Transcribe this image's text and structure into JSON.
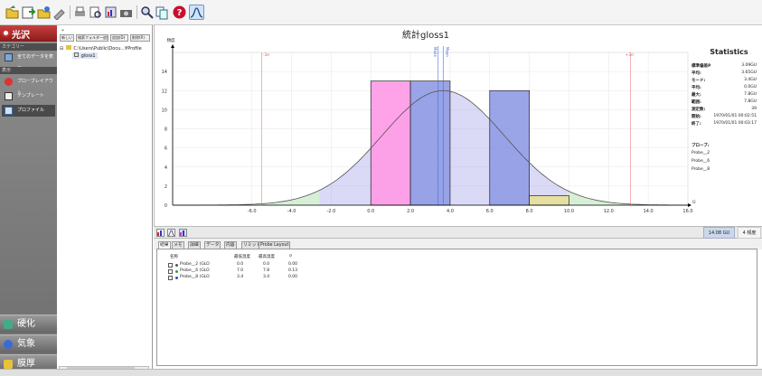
{
  "app_name": "光沢",
  "left_panel": {
    "section_file": "カテゴリー",
    "item_all_data": "全てのデータを表示",
    "section_view": "表示",
    "items": [
      "プローブレイアウト",
      "テンプレート",
      "プロファイル"
    ],
    "bottom_buttons": [
      "硬化",
      "気象",
      "膜厚"
    ]
  },
  "tree": {
    "buttons": [
      "新しい",
      "検索フォルダー追加",
      "追加(D)",
      "削除(R)"
    ],
    "path": "C:\\Users\\Public\\Docu...¥Profile",
    "item": "gloss1"
  },
  "chart_title": "統計gloss1",
  "chart_data": {
    "type": "bar",
    "title": "統計gloss1",
    "ylabel": "頻度",
    "xlabel": "GU",
    "ylim": [
      0,
      16
    ],
    "xlim": [
      -10,
      16
    ],
    "x_ticks": [
      "-6.0",
      "-4.0",
      "-2.0",
      "0.0",
      "2.0",
      "4.0",
      "6.0",
      "8.0",
      "10.0",
      "12.0",
      "14.0",
      "16.0"
    ],
    "y_ticks": [
      "0",
      "2",
      "4",
      "6",
      "8",
      "10",
      "12",
      "14"
    ],
    "bars": [
      {
        "x0": 0,
        "x1": 2,
        "value": 13,
        "color": "#ff99e6"
      },
      {
        "x0": 2,
        "x1": 4,
        "value": 13,
        "color": "#8f9be6"
      },
      {
        "x0": 6,
        "x1": 8,
        "value": 12,
        "color": "#8f9be6"
      },
      {
        "x0": 8,
        "x1": 10,
        "value": 1,
        "color": "#e6df99"
      }
    ],
    "annotations": {
      "minus3sd": "-3σ",
      "plus3sd": "+3σ",
      "mean": "Mean",
      "mode": "Mode",
      "minus3sd_x": -5.5,
      "plus3sd_x": 13.1,
      "mean_x": 3.65,
      "mode_x": 3.4
    },
    "curve_peak": {
      "mean": 3.65,
      "sd": 3.09,
      "height": 12
    }
  },
  "stats": {
    "title": "Statistics",
    "rows": [
      {
        "k": "標準偏差P",
        "v": "3.09GU"
      },
      {
        "k": "平均:",
        "v": "3.65GU"
      },
      {
        "k": "モード:",
        "v": "3.4GU"
      },
      {
        "k": "平均:",
        "v": "0.0GU"
      },
      {
        "k": "最大:",
        "v": "7.8GU"
      },
      {
        "k": "範囲:",
        "v": "7.8GU"
      },
      {
        "k": "測定数:",
        "v": "39"
      },
      {
        "k": "開始:",
        "v": "1970/01/01 00:02:51"
      },
      {
        "k": "終了:",
        "v": "1970/01/01 00:03:17"
      }
    ],
    "probe_title": "プローブ:",
    "probes": [
      "Probe__2",
      "Probe__6",
      "Probe__8"
    ]
  },
  "status": {
    "gu_value": "14.08",
    "gu_unit": "GU",
    "count_value": "4",
    "count_unit": "頻度"
  },
  "tabs": [
    "結果",
    "メモ",
    "詳細",
    "データ",
    "内容",
    "リミット",
    "Probe Layout"
  ],
  "table": {
    "headers": [
      "名称",
      "最低温度",
      "最高温度",
      "σ"
    ],
    "rows": [
      {
        "name": "Probe__2 (GLO",
        "min": "0.0",
        "max": "0.0",
        "sd": "0.00",
        "color": "#555555"
      },
      {
        "name": "Probe__6 (GLO",
        "min": "7.0",
        "max": "7.8",
        "sd": "0.13",
        "color": "#3b9a3b"
      },
      {
        "name": "Probe__8 (GLO",
        "min": "3.4",
        "max": "3.4",
        "sd": "0.00",
        "color": "#2a4fbf"
      }
    ]
  }
}
